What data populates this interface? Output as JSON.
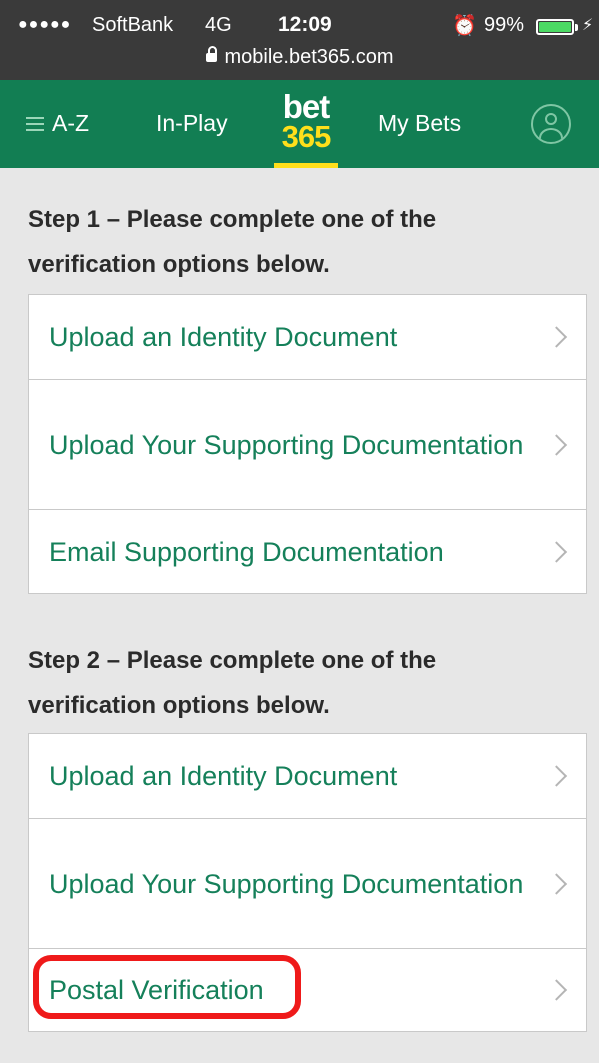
{
  "status_bar": {
    "signal": "●●●●●",
    "carrier": "SoftBank",
    "network": "4G",
    "time": "12:09",
    "alarm_icon": "alarm-clock-icon",
    "battery_percent": "99%",
    "url": "mobile.bet365.com"
  },
  "nav": {
    "az_label": "A-Z",
    "inplay_label": "In-Play",
    "logo_top": "bet",
    "logo_bottom": "365",
    "mybets_label": "My Bets"
  },
  "step1": {
    "heading": "Step 1 – Please complete one of the verification options below.",
    "options": [
      "Upload an Identity Document",
      "Upload Your Supporting Documentation",
      "Email Supporting Documentation"
    ]
  },
  "step2": {
    "heading": "Step 2 – Please complete one of the verification options below.",
    "options": [
      "Upload an Identity Document",
      "Upload Your Supporting Documentation",
      "Postal Verification"
    ]
  },
  "colors": {
    "brand_green": "#127e53",
    "link_green": "#15805a",
    "logo_yellow": "#ffdf1b",
    "highlight_red": "#ef1a1a"
  }
}
